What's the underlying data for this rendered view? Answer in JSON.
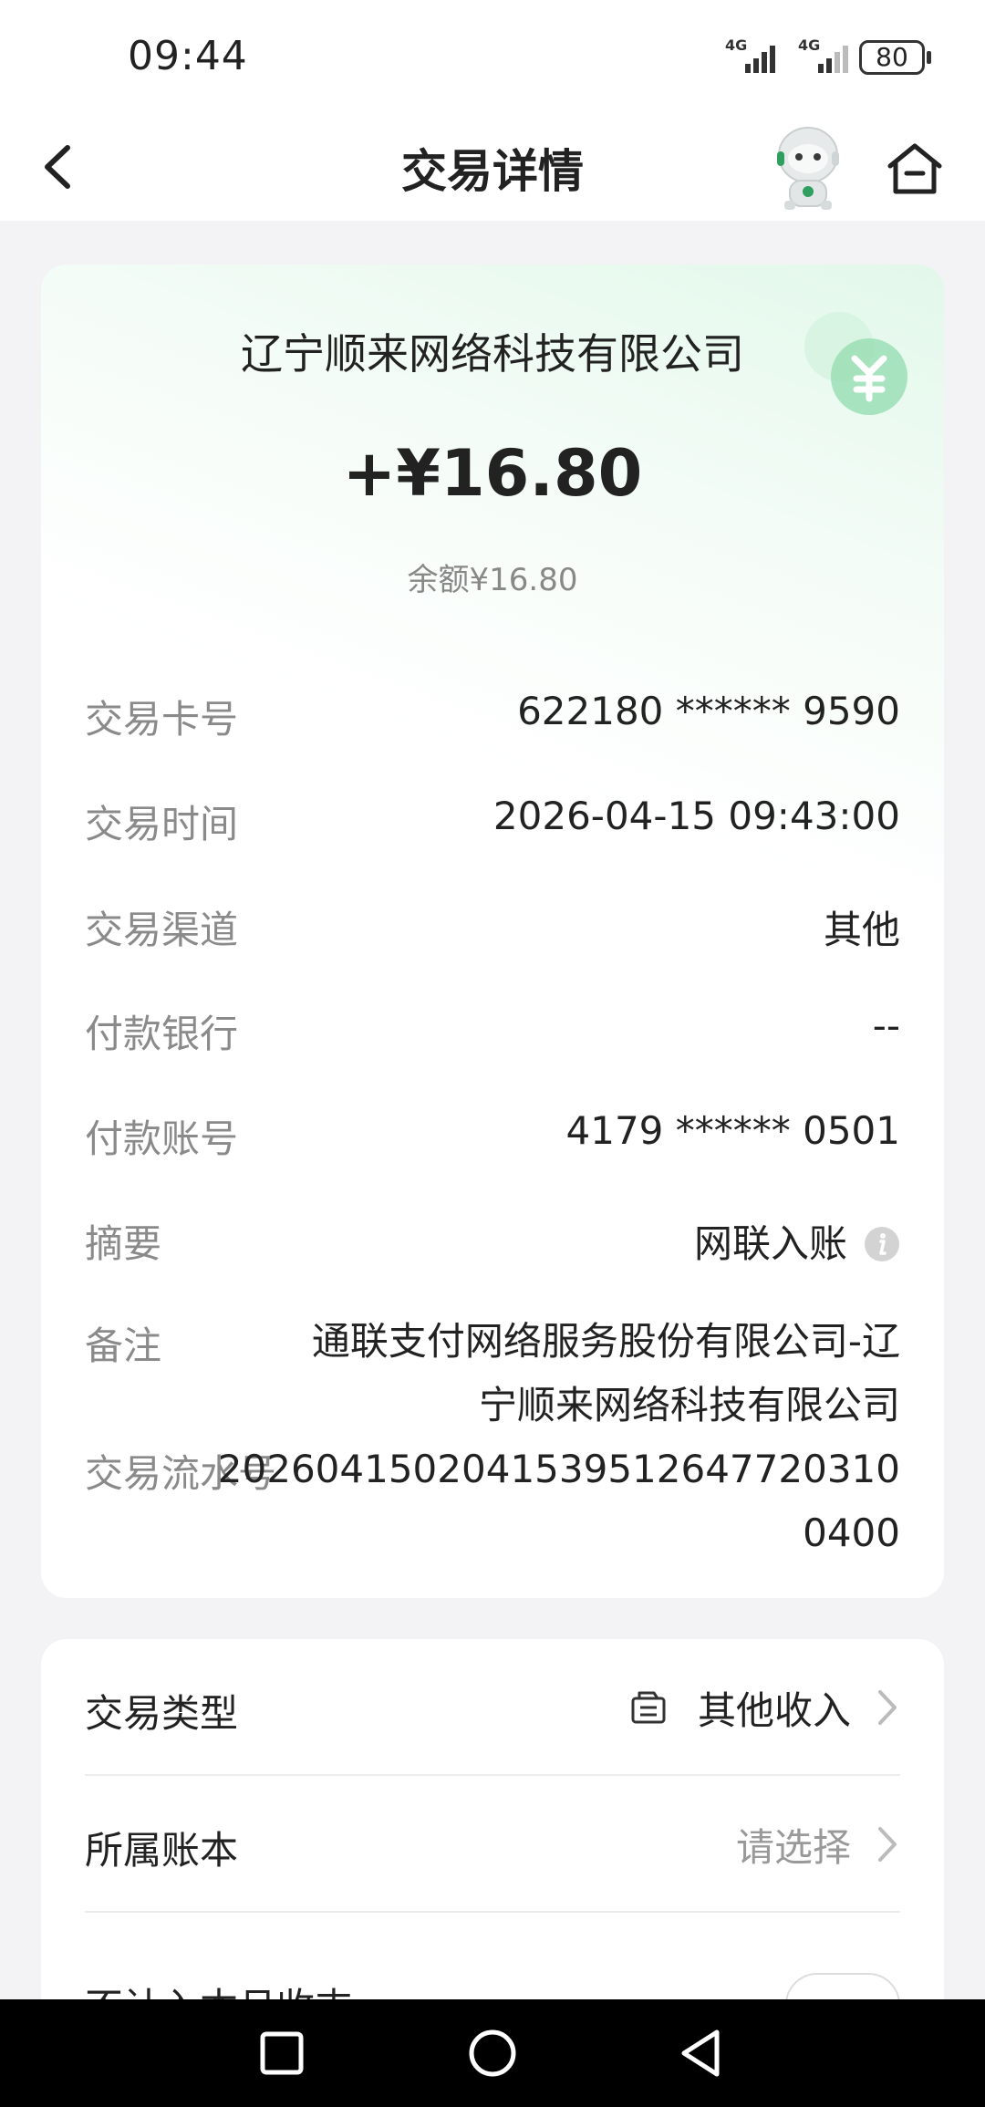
{
  "status_bar": {
    "time": "09:44",
    "signal1_label": "4G",
    "signal2_label": "4G",
    "battery": "80"
  },
  "nav": {
    "title": "交易详情",
    "back_icon": "chevron-left-icon",
    "assistant_icon": "robot-assistant-icon",
    "home_icon": "home-icon"
  },
  "transaction": {
    "company": "辽宁顺来网络科技有限公司",
    "amount": "+¥16.80",
    "balance": "余额¥16.80",
    "rows": [
      {
        "label": "交易卡号",
        "value": "622180 ****** 9590"
      },
      {
        "label": "交易时间",
        "value": "2026-04-15 09:43:00"
      },
      {
        "label": "交易渠道",
        "value": "其他"
      },
      {
        "label": "付款银行",
        "value": "--"
      },
      {
        "label": "付款账号",
        "value": "4179 ****** 0501"
      },
      {
        "label": "摘要",
        "value": "网联入账"
      },
      {
        "label": "备注",
        "value_line1": "通联支付网络服务股份有限公司-辽",
        "value_line2": "宁顺来网络科技有限公司"
      },
      {
        "label": "交易流水号",
        "value_line1": "2026041502041539512647720310",
        "value_line2": "0400"
      }
    ]
  },
  "settings": {
    "type_label": "交易类型",
    "type_value": "其他收入",
    "book_label": "所属账本",
    "book_value": "请选择",
    "exclude_label": "不计入本月收支"
  },
  "colors": {
    "accent_green": "#4cc482",
    "background": "#f3f3f5"
  }
}
